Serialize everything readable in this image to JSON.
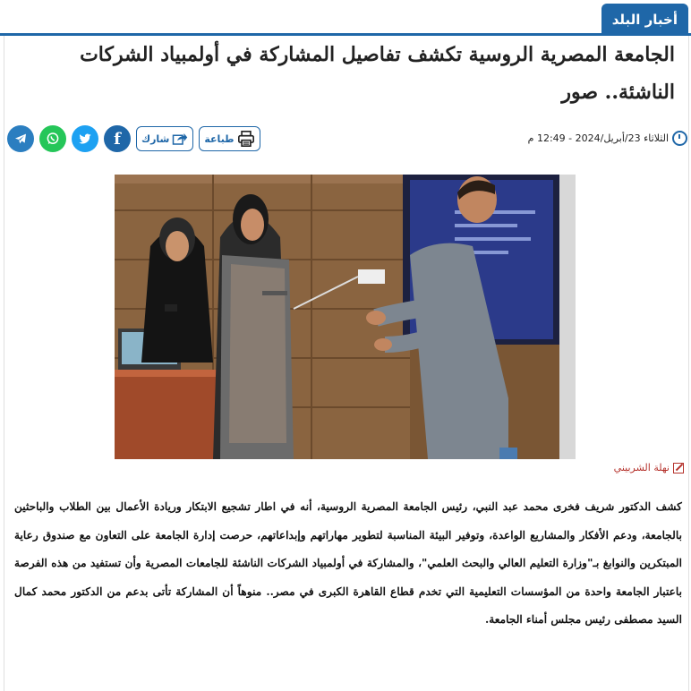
{
  "section": {
    "label": "أخبار البلد"
  },
  "article": {
    "title": "الجامعة المصرية الروسية تكشف تفاصيل المشاركة في أولمبياد الشركات الناشئة.. صور",
    "date": "الثلاثاء 23/أبريل/2024 - 12:49 م",
    "author": "نهلة الشربيني",
    "body": "كشف الدكتور شريف فخرى محمد عبد النبي، رئيس الجامعة المصرية الروسية، أنه في اطار تشجيع الابتكار وريادة الأعمال بين الطلاب والباحثين بالجامعة، ودعم الأفكار والمشاريع الواعدة، وتوفير البيئة المناسبة لتطوير مهاراتهم وإبداعاتهم، حرصت إدارة الجامعة على التعاون مع صندوق رعاية المبتكرين والنوابغ بـ\"وزارة التعليم العالي والبحث العلمي\"، والمشاركة في أولمبياد الشركات الناشئة للجامعات المصرية وأن تستفيد من هذه الفرصة باعتبار الجامعة واحدة من المؤسسات التعليمية التي تخدم قطاع القاهرة الكبرى في مصر.. منوهاً أن المشاركة تأتى بدعم من الدكتور محمد كمال السيد مصطفى رئيس مجلس أمناء الجامعة."
  },
  "actions": {
    "print_label": "طباعة",
    "share_label": "شارك",
    "icons": [
      "print-icon",
      "share-icon",
      "facebook-icon",
      "twitter-icon",
      "whatsapp-icon",
      "telegram-icon"
    ]
  },
  "colors": {
    "brand": "#1f67a8",
    "author": "#b5322c",
    "whatsapp": "#25c659",
    "twitter": "#1da1f2"
  }
}
